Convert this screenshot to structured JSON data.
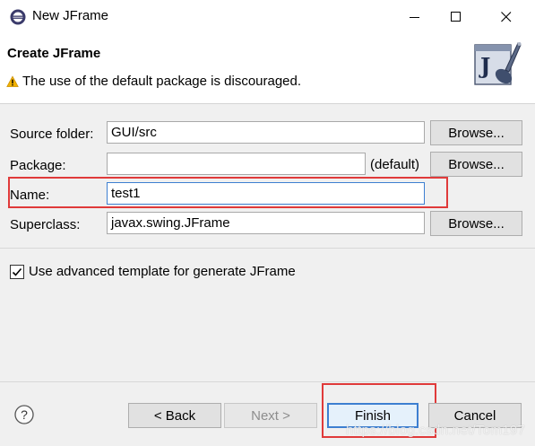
{
  "window": {
    "title": "New JFrame",
    "min_icon": "minimize-icon",
    "max_icon": "maximize-icon",
    "close_icon": "close-icon"
  },
  "banner": {
    "title": "Create JFrame",
    "message": "The use of the default package is discouraged.",
    "warning_icon": "warning-icon",
    "image_icon": "jframe-wizard-icon"
  },
  "form": {
    "source_folder": {
      "label": "Source folder:",
      "value": "GUI/src",
      "browse": "Browse..."
    },
    "package": {
      "label": "Package:",
      "value": "",
      "suffix": "(default)",
      "browse": "Browse..."
    },
    "name": {
      "label": "Name:",
      "value": "test1"
    },
    "superclass": {
      "label": "Superclass:",
      "value": "javax.swing.JFrame",
      "browse": "Browse..."
    },
    "advanced_template": {
      "label": "Use advanced template for generate JFrame",
      "checked": true
    }
  },
  "buttons": {
    "back": "< Back",
    "next": "Next >",
    "finish": "Finish",
    "cancel": "Cancel",
    "help_icon": "help-icon"
  },
  "watermark": "https://blog.csdn.net/Tom197",
  "colors": {
    "highlight_box": "#e03a3a",
    "focus_border": "#3d7fd1",
    "warning": "#f0b000"
  }
}
